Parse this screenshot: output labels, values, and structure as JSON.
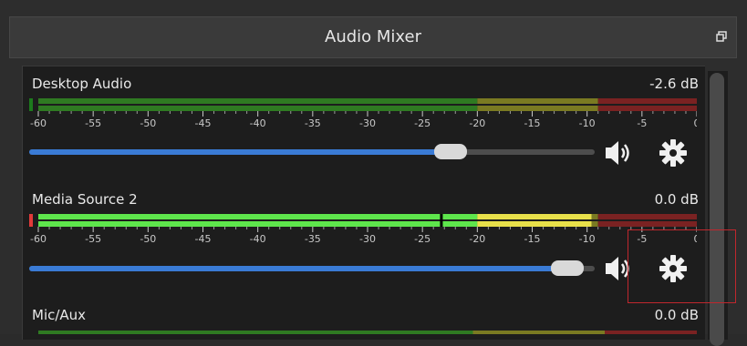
{
  "dock": {
    "title": "Audio Mixer",
    "float_icon": "undock-icon"
  },
  "channels": [
    {
      "name": "Desktop Audio",
      "volume_db": "-2.6 dB",
      "meter_level": 0.0,
      "fader_level": 0.76,
      "scale": [
        "-60",
        "-55",
        "-50",
        "-45",
        "-40",
        "-35",
        "-30",
        "-25",
        "-20",
        "-15",
        "-10",
        "-5",
        "0"
      ],
      "mute_icon": "speaker-icon",
      "settings_icon": "gear-icon"
    },
    {
      "name": "Media Source 2",
      "volume_db": "0.0 dB",
      "meter_level": 0.84,
      "peak_level": 0.61,
      "fader_level": 0.98,
      "scale": [
        "-60",
        "-55",
        "-50",
        "-45",
        "-40",
        "-35",
        "-30",
        "-25",
        "-20",
        "-15",
        "-10",
        "-5",
        "0"
      ],
      "mute_icon": "speaker-icon",
      "settings_icon": "gear-icon"
    },
    {
      "name": "Mic/Aux",
      "volume_db": "0.0 dB"
    }
  ],
  "colors": {
    "green_dim": "#2f7a22",
    "yellow_dim": "#7a7a22",
    "red_dim": "#7a2222",
    "green": "#5ee64c",
    "yellow": "#e8e04a",
    "red": "#e23a3a",
    "fader": "#3a7bd5",
    "highlight": "#c0272d"
  }
}
